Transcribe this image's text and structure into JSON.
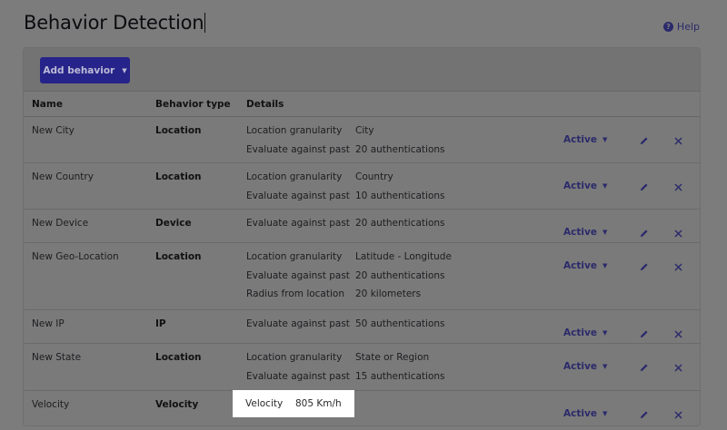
{
  "page": {
    "title": "Behavior Detection",
    "help_label": "Help"
  },
  "toolbar": {
    "add_label": "Add behavior"
  },
  "table": {
    "headers": {
      "name": "Name",
      "type": "Behavior type",
      "details": "Details"
    },
    "status_label": "Active",
    "rows": [
      {
        "name": "New City",
        "type": "Location",
        "details": [
          {
            "k": "Location granularity",
            "v": "City"
          },
          {
            "k": "Evaluate against past",
            "v": "20 authentications"
          }
        ]
      },
      {
        "name": "New Country",
        "type": "Location",
        "details": [
          {
            "k": "Location granularity",
            "v": "Country"
          },
          {
            "k": "Evaluate against past",
            "v": "10 authentications"
          }
        ]
      },
      {
        "name": "New Device",
        "type": "Device",
        "details": [
          {
            "k": "Evaluate against past",
            "v": "20 authentications"
          }
        ]
      },
      {
        "name": "New Geo-Location",
        "type": "Location",
        "details": [
          {
            "k": "Location granularity",
            "v": "Latitude - Longitude"
          },
          {
            "k": "Evaluate against past",
            "v": "20 authentications"
          },
          {
            "k": "Radius from location",
            "v": "20 kilometers"
          }
        ]
      },
      {
        "name": "New IP",
        "type": "IP",
        "details": [
          {
            "k": "Evaluate against past",
            "v": "50 authentications"
          }
        ]
      },
      {
        "name": "New State",
        "type": "Location",
        "details": [
          {
            "k": "Location granularity",
            "v": "State or Region"
          },
          {
            "k": "Evaluate against past",
            "v": "15 authentications"
          }
        ]
      },
      {
        "name": "Velocity",
        "type": "Velocity",
        "details": [
          {
            "k": "Velocity",
            "v": "805 Km/h"
          }
        ]
      }
    ]
  },
  "colors": {
    "accent": "#26248a",
    "overlay": "#7c7c7c",
    "highlight": "#ffffff"
  },
  "icons": {
    "help": "question-circle-icon",
    "dropdown": "caret-down-icon",
    "edit": "pencil-icon",
    "delete": "x-icon"
  }
}
